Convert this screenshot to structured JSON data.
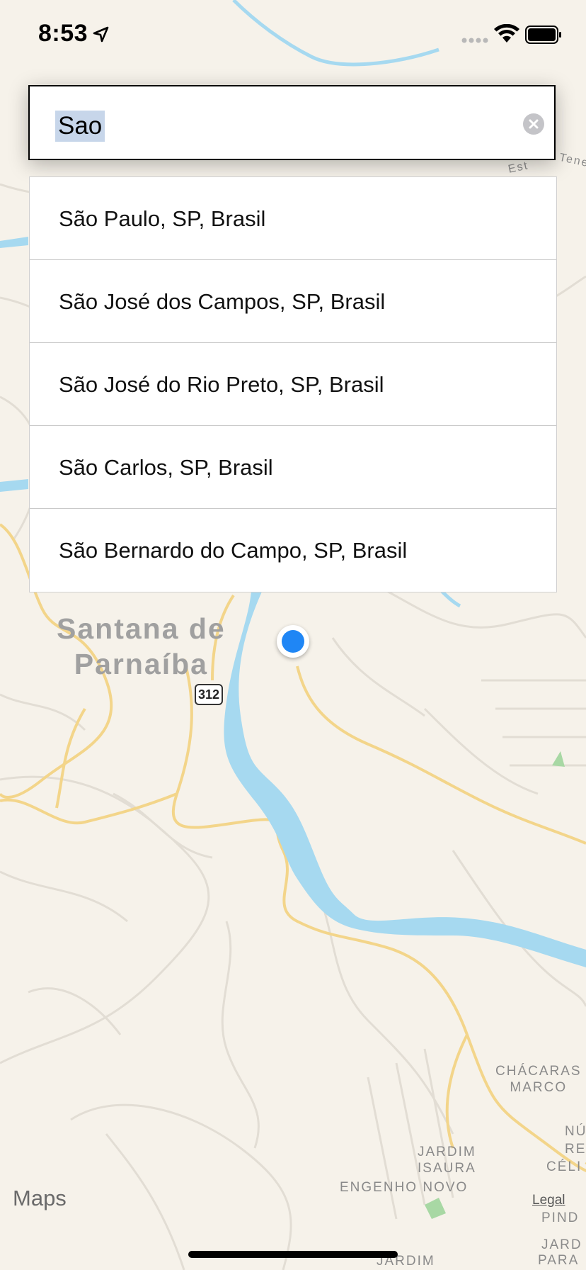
{
  "status_bar": {
    "time": "8:53"
  },
  "search": {
    "query": "Sao"
  },
  "suggestions": [
    "São Paulo, SP, Brasil",
    "São José dos Campos, SP, Brasil",
    "São José do Rio Preto, SP, Brasil",
    "São Carlos, SP, Brasil",
    "São Bernardo do Campo, SP, Brasil"
  ],
  "map": {
    "city_label_line1": "Santana de",
    "city_label_line2": "Parnaíba",
    "road_shield": "312",
    "districts": {
      "chacaras_marco_1": "CHÁCARAS",
      "chacaras_marco_2": "MARCO",
      "jardim_isaura_1": "JARDIM",
      "jardim_isaura_2": "ISAURA",
      "engenho_novo": "ENGENHO NOVO",
      "jardim_bottom": "JARDIM",
      "partial_nu": "NÚ",
      "partial_resi": "RESI",
      "partial_celi": "CÉLI",
      "partial_pind": "PIND",
      "partial_jard": "JARD",
      "partial_para": "PARA",
      "road_top_1": "Est",
      "road_top_2": "Tene"
    },
    "attribution": "Maps",
    "legal": "Legal",
    "colors": {
      "water": "#a6d9f0",
      "land": "#f6f2ea",
      "road_major": "#f5d98e",
      "road_minor": "#e3ded6",
      "user_dot": "#1f86f5"
    }
  }
}
